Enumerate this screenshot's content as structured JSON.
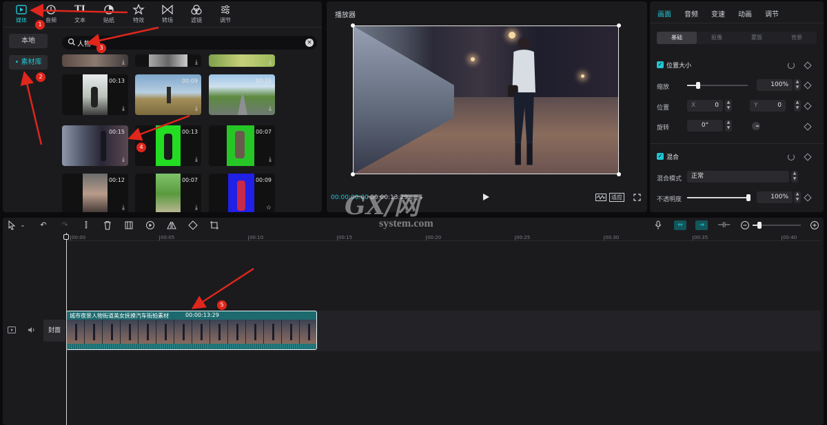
{
  "media": {
    "tabs": [
      {
        "label": "媒体",
        "icon": "media-icon",
        "active": true
      },
      {
        "label": "音频",
        "icon": "audio-icon"
      },
      {
        "label": "文本",
        "icon": "text-icon"
      },
      {
        "label": "贴纸",
        "icon": "sticker-icon"
      },
      {
        "label": "特效",
        "icon": "effects-icon"
      },
      {
        "label": "转场",
        "icon": "transition-icon"
      },
      {
        "label": "滤镜",
        "icon": "filter-icon"
      },
      {
        "label": "调节",
        "icon": "adjust-icon"
      }
    ],
    "side": {
      "local": "本地",
      "library": "素材库"
    },
    "search": {
      "value": "人物"
    },
    "thumbs": [
      {
        "duration": "00:13"
      },
      {
        "duration": "00:09"
      },
      {
        "duration": "00:15"
      },
      {
        "duration": "00:15"
      },
      {
        "duration": "00:13"
      },
      {
        "duration": "00:07"
      },
      {
        "duration": "00:12"
      },
      {
        "duration": "00:07"
      },
      {
        "duration": "00:09"
      }
    ]
  },
  "player": {
    "title": "播放器",
    "current_time": "00:00:00:00",
    "total_time": "00:00:13:29",
    "ratio_label": "画质",
    "fit_label": "适应"
  },
  "props": {
    "tabs": [
      "画面",
      "音频",
      "变速",
      "动画",
      "调节"
    ],
    "subtabs": [
      "基础",
      "抠像",
      "蒙版",
      "背景"
    ],
    "position_size": {
      "title": "位置大小",
      "scale_label": "缩放",
      "scale_value": "100%",
      "scale_fraction": 0.18,
      "position_label": "位置",
      "x_label": "X",
      "x_value": "0",
      "y_label": "Y",
      "y_value": "0",
      "rotate_label": "旋转",
      "rotate_value": "0°"
    },
    "blend": {
      "title": "混合",
      "mode_label": "混合模式",
      "mode_value": "正常",
      "opacity_label": "不透明度",
      "opacity_value": "100%"
    }
  },
  "timeline": {
    "ticks": [
      "00:00",
      "00:05",
      "00:10",
      "00:15",
      "00:20",
      "00:25",
      "00:30",
      "00:35",
      "00:40"
    ],
    "clip_title": "城市夜景人物街道美女抚摸汽车街拍素材",
    "clip_duration": "00:00:13:29",
    "cover_label": "封面"
  },
  "watermark": {
    "big": "GX/网",
    "small": "system.com"
  },
  "annotations": [
    "1",
    "2",
    "3",
    "4",
    "5"
  ],
  "colors": {
    "accent": "#21c6d3",
    "annotation": "#e1261c",
    "clip": "#1c6a6e"
  }
}
